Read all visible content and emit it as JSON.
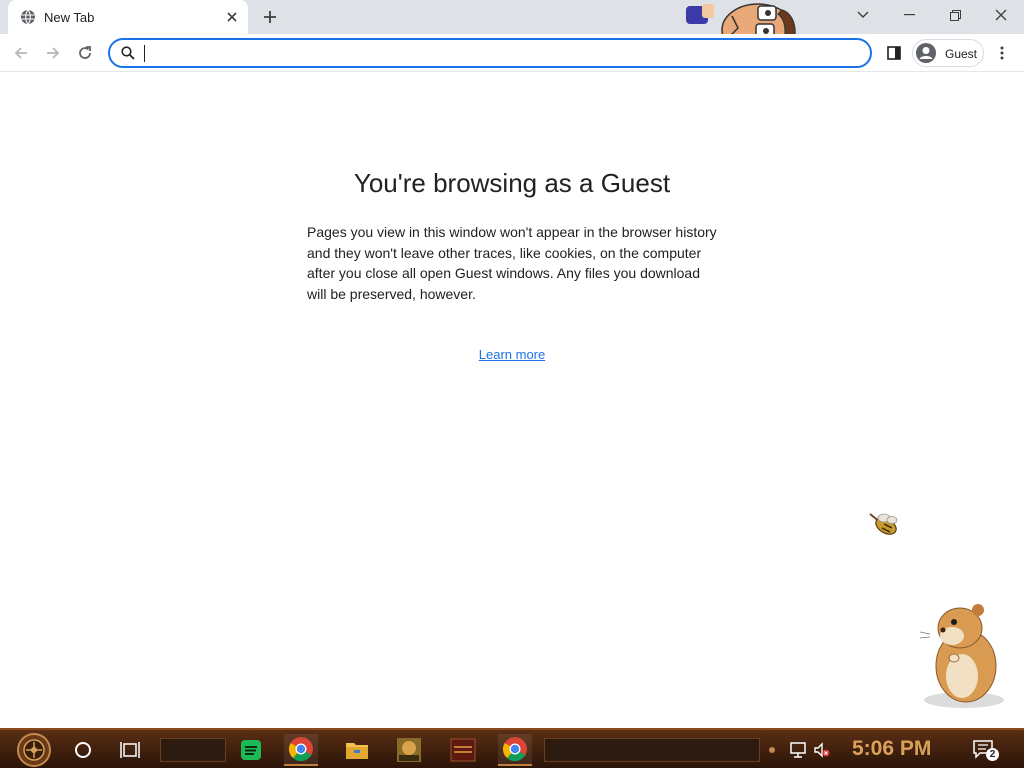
{
  "tab": {
    "title": "New Tab",
    "favicon": "globe-icon"
  },
  "toolbar": {
    "omnibox_value": "",
    "profile_label": "Guest"
  },
  "page": {
    "heading": "You're browsing as a Guest",
    "body": "Pages you view in this window won't appear in the browser history and they won't leave other traces, like cookies, on the computer after you close all open Guest windows. Any files you download will be preserved, however.",
    "link": "Learn more"
  },
  "colors": {
    "accent": "#1a73e8",
    "tabstrip": "#dee1e6",
    "taskbar": "#3c1e0c",
    "clock": "#d8a25a"
  },
  "taskbar": {
    "clock": "5:06 PM",
    "notification_count": "2",
    "apps": [
      "spotify-icon",
      "chrome-icon",
      "file-explorer-icon",
      "game-icon",
      "game-icon-2",
      "chrome-icon-2"
    ]
  }
}
